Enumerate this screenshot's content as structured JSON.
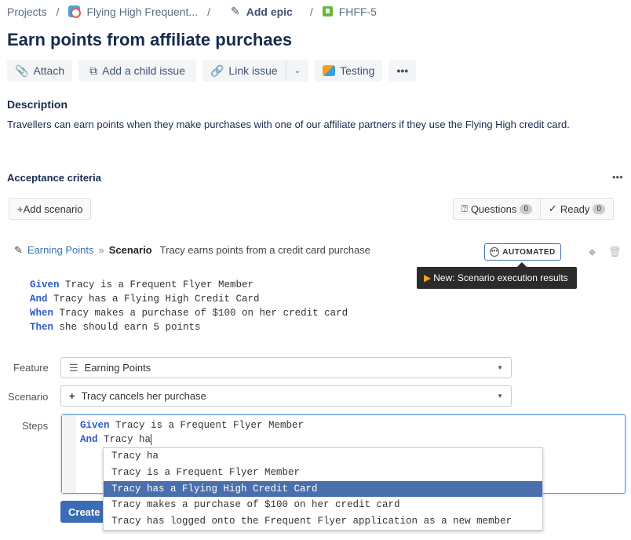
{
  "breadcrumb": {
    "projects": "Projects",
    "project": "Flying High Frequent...",
    "epic": "Add epic",
    "issue": "FHFF-5"
  },
  "title": "Earn points from affiliate purchaes",
  "toolbar": {
    "attach": "Attach",
    "child": "Add a child issue",
    "link": "Link issue",
    "testing": "Testing"
  },
  "description": {
    "heading": "Description",
    "text": "Travellers can earn points when they make purchases with one of our affiliate partners if they use the Flying High credit card."
  },
  "acceptance": {
    "heading": "Acceptance criteria",
    "add_scenario": "+Add scenario",
    "questions": "Questions",
    "questions_count": "0",
    "ready": "Ready",
    "ready_count": "0"
  },
  "scenario": {
    "feature": "Earning Points",
    "sep": "»",
    "label": "Scenario",
    "name": "Tracy earns points from a credit card purchase",
    "status": "AUTOMATED",
    "tooltip": "New: Scenario execution results",
    "steps": [
      {
        "kw": "Given",
        "text": " Tracy is a Frequent Flyer Member"
      },
      {
        "kw": "And",
        "text": " Tracy has a Flying High Credit Card"
      },
      {
        "kw": "When",
        "text": " Tracy makes a purchase of $100 on her credit card"
      },
      {
        "kw": "Then",
        "text": " she should earn 5 points"
      }
    ]
  },
  "form": {
    "feature_label": "Feature",
    "feature_value": "Earning Points",
    "scenario_label": "Scenario",
    "scenario_value": "Tracy cancels her purchase",
    "steps_label": "Steps",
    "editor": [
      {
        "kw": "Given",
        "text": " Tracy is a Frequent Flyer Member"
      },
      {
        "kw": "And",
        "text": " Tracy ha"
      }
    ],
    "suggestions": [
      "Tracy ha",
      "Tracy is a Frequent Flyer Member",
      "Tracy has a Flying High Credit Card",
      "Tracy makes a purchase of $100 on her credit card",
      "Tracy has logged onto the Frequent Flyer application as a new member"
    ],
    "create": "Create"
  },
  "colors": {
    "accent": "#3b73af",
    "highlight": "#4a6fad",
    "keyword": "#2d5ac7"
  }
}
